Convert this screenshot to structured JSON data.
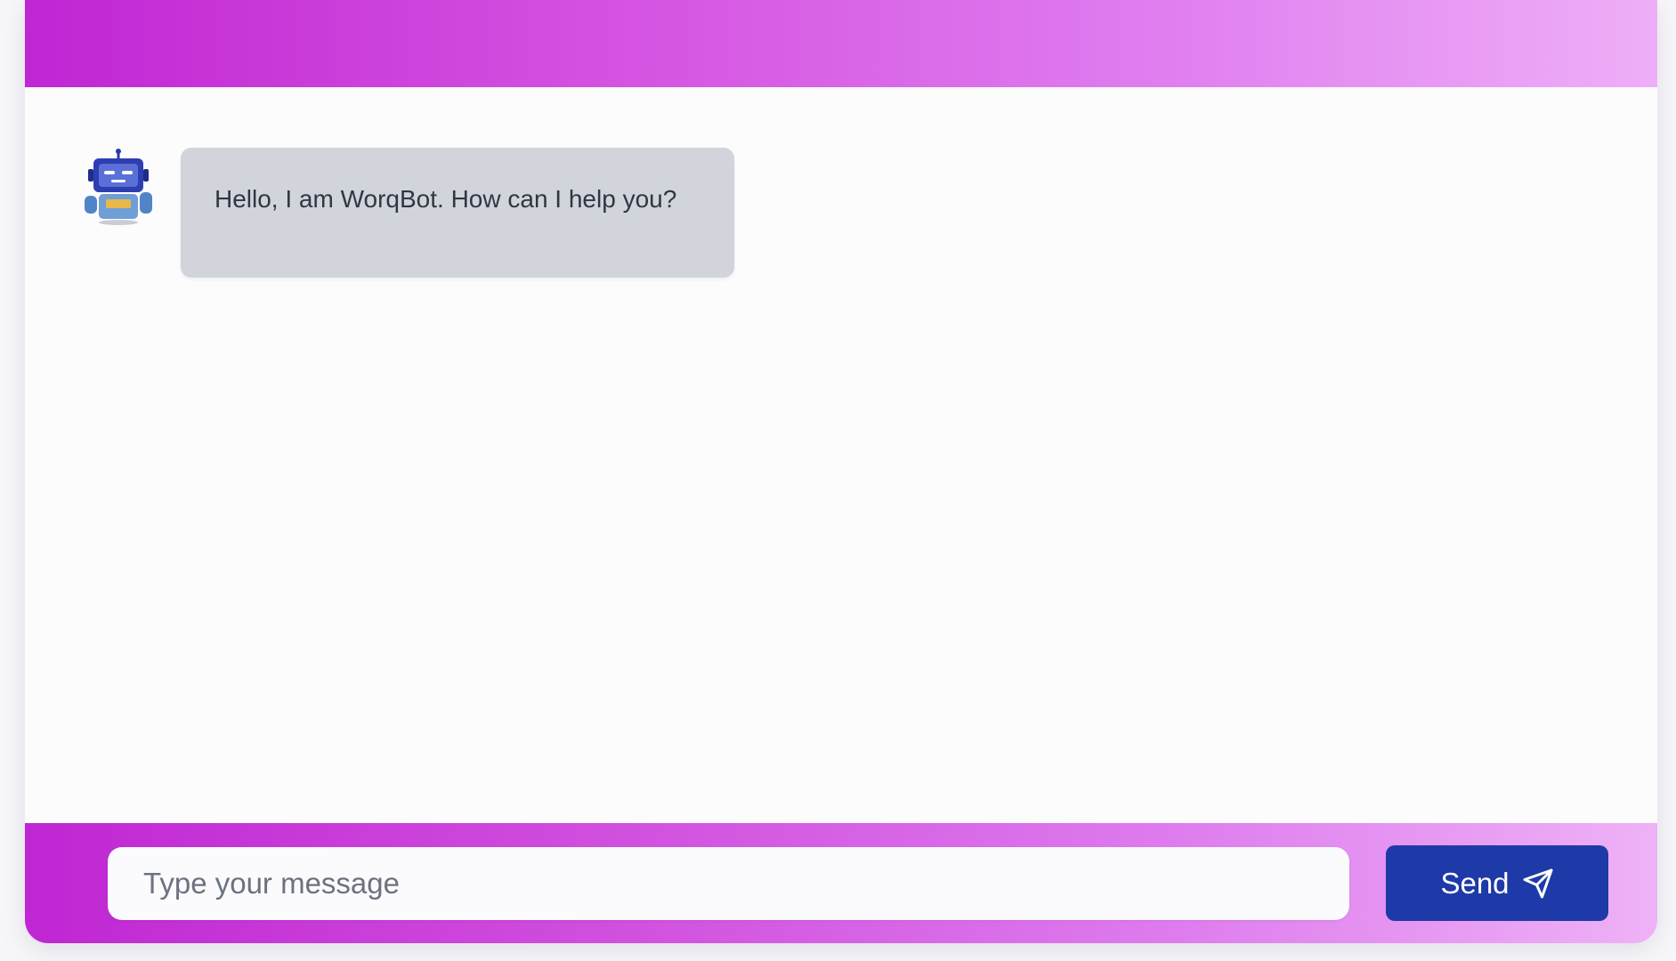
{
  "chat": {
    "messages": [
      {
        "sender": "bot",
        "avatar_icon": "robot-icon",
        "text": "Hello, I am WorqBot. How can I help you?"
      }
    ]
  },
  "composer": {
    "placeholder": "Type your message",
    "value": "",
    "send_label": "Send",
    "send_icon": "paper-plane-icon"
  },
  "colors": {
    "header_gradient_start": "#c026d3",
    "header_gradient_end": "#eeaff7",
    "bubble_background": "#d1d5db",
    "send_button": "#1e3aa8"
  }
}
